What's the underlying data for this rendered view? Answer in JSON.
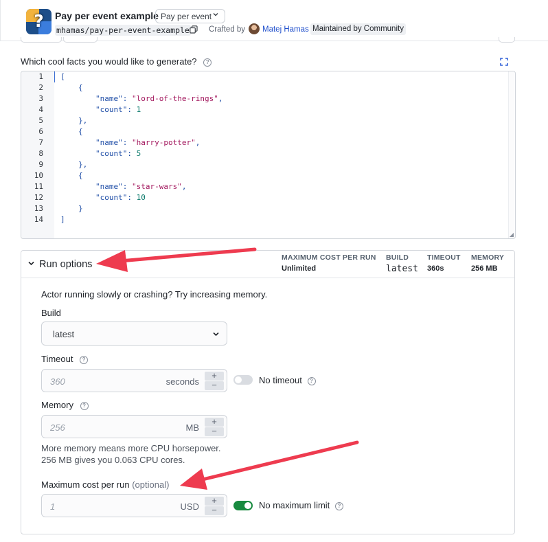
{
  "header": {
    "title": "Pay per event example",
    "pricing_selector": "Pay per event",
    "slug": "mhamas/pay-per-event-example",
    "crafted_by_label": "Crafted by",
    "author": "Matej Hamas",
    "badge": "Maintained by Community"
  },
  "input": {
    "label": "Which cool facts you would like to generate?",
    "line_numbers": [
      "1",
      "2",
      "3",
      "4",
      "5",
      "6",
      "7",
      "8",
      "9",
      "10",
      "11",
      "12",
      "13",
      "14"
    ],
    "items": [
      {
        "name": "lord-of-the-rings",
        "count": 1
      },
      {
        "name": "harry-potter",
        "count": 5
      },
      {
        "name": "star-wars",
        "count": 10
      }
    ],
    "code_tokens": {
      "open_bracket": "[",
      "close_bracket": "]",
      "open_brace": "{",
      "close_brace": "}",
      "close_brace_comma": "},",
      "name_key": "\"name\"",
      "count_key": "\"count\"",
      "colon": ":",
      "comma": ",",
      "str_1": "\"lord-of-the-rings\"",
      "str_2": "\"harry-potter\"",
      "str_3": "\"star-wars\"",
      "num_1": "1",
      "num_2": "5",
      "num_3": "10"
    }
  },
  "run_options": {
    "title": "Run options",
    "stats": [
      {
        "label": "MAXIMUM COST PER RUN",
        "value": "Unlimited"
      },
      {
        "label": "BUILD",
        "value": "latest"
      },
      {
        "label": "TIMEOUT",
        "value": "360s"
      },
      {
        "label": "MEMORY",
        "value": "256 MB"
      }
    ],
    "hint": "Actor running slowly or crashing? Try increasing memory.",
    "build": {
      "label": "Build",
      "value": "latest"
    },
    "timeout": {
      "label": "Timeout",
      "placeholder": "360",
      "unit": "seconds",
      "toggle_label": "No timeout",
      "toggle_on": false
    },
    "memory": {
      "label": "Memory",
      "placeholder": "256",
      "unit": "MB",
      "note_line1": "More memory means more CPU horsepower.",
      "note_line2": "256 MB gives you 0.063 CPU cores."
    },
    "max_cost": {
      "label": "Maximum cost per run",
      "optional": "(optional)",
      "placeholder": "1",
      "unit": "USD",
      "toggle_label": "No maximum limit",
      "toggle_on": true
    },
    "step_plus": "+",
    "step_minus": "−"
  },
  "colors": {
    "annotation_arrow": "#ee3b4f",
    "toggle_on": "#188a3f",
    "link": "#1f4fcc"
  }
}
